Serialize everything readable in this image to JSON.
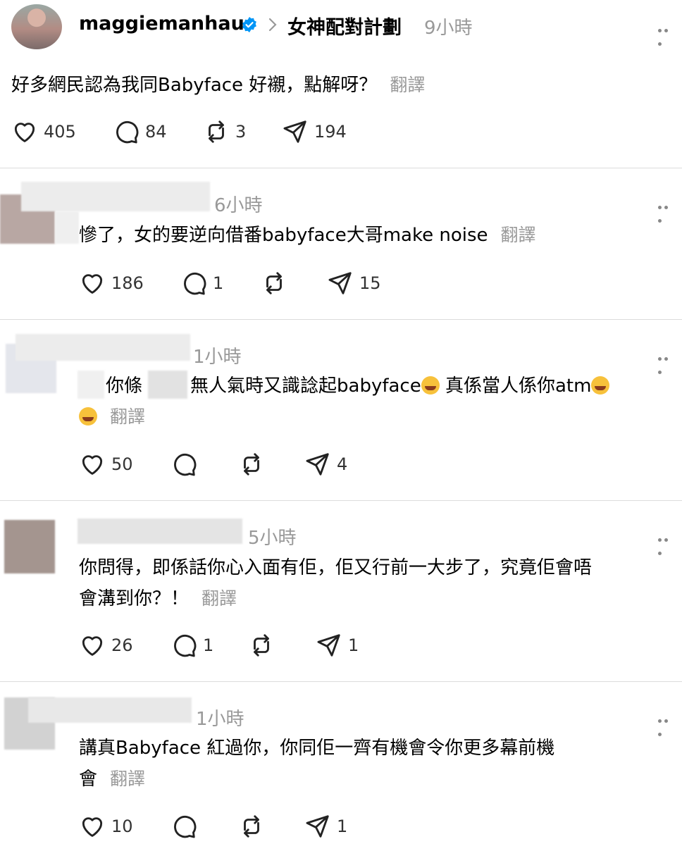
{
  "post": {
    "username": "maggiemanhau",
    "topic": "女神配對計劃",
    "time": "9小時",
    "text": "好多網民認為我同Babyface 好襯，點解呀？",
    "translate": "翻譯",
    "likes": "405",
    "comments": "84",
    "reposts": "3",
    "shares": "194"
  },
  "comments": [
    {
      "time": "6小時",
      "line1": "慘了，女的要逆向借番babyface大哥make noise",
      "translate": "翻譯",
      "likes": "186",
      "comments": "1",
      "reposts": "",
      "shares": "15"
    },
    {
      "time": "1小時",
      "part_a": "你條",
      "part_b": "無人氣時又識諗起babyface",
      "part_c": " 真係當人係你atm",
      "translate": "翻譯",
      "likes": "50",
      "comments": "",
      "reposts": "",
      "shares": "4"
    },
    {
      "time": "5小時",
      "line1": "你問得，即係話你心入面有佢，佢又行前一大步了，究竟佢會唔",
      "line2": "會溝到你？！",
      "translate": "翻譯",
      "likes": "26",
      "comments": "1",
      "reposts": "",
      "shares": "1"
    },
    {
      "time": "1小時",
      "line1": "講真Babyface 紅過你，你同佢一齊有機會令你更多幕前機",
      "line2": "會",
      "translate": "翻譯",
      "likes": "10",
      "comments": "",
      "reposts": "",
      "shares": "1"
    }
  ],
  "icons": {
    "like": "heart-icon",
    "comment": "comment-bubble-icon",
    "repost": "repost-icon",
    "share": "send-icon",
    "more": "more-icon",
    "verified": "verified-badge-icon"
  },
  "colors": {
    "verified": "#0095f6",
    "muted": "#999999"
  }
}
